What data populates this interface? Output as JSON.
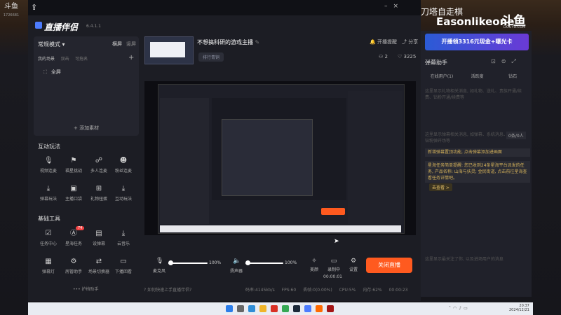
{
  "overlay": {
    "logo": "斗鱼",
    "logo_sub": "1726681",
    "streamer_name": "刀塔自走棋",
    "streamer_id": "Easonlikeone",
    "brand": "斗鱼",
    "brand_url": "DOUYU.COM"
  },
  "app": {
    "name": "直播伴侣",
    "version": "6.4.1.1",
    "mode": "常规模式 ▾",
    "orient_h": "横屏",
    "orient_v": "竖屏",
    "scene_tabs": [
      "我的场景",
      "双击",
      "可拖名"
    ],
    "source_item": "全屏",
    "add_source": "+ 添加素材"
  },
  "interact": {
    "title": "互动玩法",
    "items": [
      {
        "label": "视频连麦",
        "icon": "mic-icon"
      },
      {
        "label": "福星挑战",
        "icon": "star-icon"
      },
      {
        "label": "多人连麦",
        "icon": "people-icon"
      },
      {
        "label": "粉丝连麦",
        "icon": "fans-icon"
      },
      {
        "label": "弹幕玩法",
        "icon": "download-icon"
      },
      {
        "label": "主播口袋",
        "icon": "pocket-icon"
      },
      {
        "label": "礼物扭蛋",
        "icon": "gift-icon"
      },
      {
        "label": "互动玩法",
        "icon": "game-icon"
      }
    ]
  },
  "tools": {
    "title": "基础工具",
    "badge": "74",
    "items": [
      {
        "label": "任务中心",
        "icon": "task-icon"
      },
      {
        "label": "星海任务",
        "icon": "ad-icon"
      },
      {
        "label": "设弹幕",
        "icon": "danmu-icon"
      },
      {
        "label": "云音乐",
        "icon": "music-icon"
      },
      {
        "label": "弹幕灯",
        "icon": "lamp-icon"
      },
      {
        "label": "房管助手",
        "icon": "admin-icon"
      },
      {
        "label": "场景切换器",
        "icon": "switch-icon"
      },
      {
        "label": "下播回看",
        "icon": "replay-icon"
      }
    ],
    "more": "••• 护档助手"
  },
  "header": {
    "stream_title": "不想搞科研的游戏主播",
    "category": "排行青铜",
    "open_alert": "开播提醒",
    "share": "分享",
    "connections": "2",
    "likes": "3225"
  },
  "controls": {
    "mic_label": "麦克风",
    "mic_value": "100%",
    "speaker_label": "扬声器",
    "speaker_value": "100%",
    "beauty_label": "美颜",
    "record_label": "录制中",
    "record_time": "00:00:01",
    "settings_label": "设置",
    "end_live": "关闭直播"
  },
  "status": {
    "help": "如何快速上手直播伴侣?",
    "bitrate": "码率:4145kb/s",
    "fps": "FPS:60",
    "drop": "丢帧:0(0.00%)",
    "cpu": "CPU:5%",
    "mem": "内存:62%",
    "time": "00:00:23"
  },
  "right": {
    "banner": "开播领3316元现金+曝光卡",
    "title": "弹幕助手",
    "tabs": [
      "在线用户(1)",
      "活跃度",
      "钻石"
    ],
    "hint1": "这里显示礼物相关消息, 如礼物、送礼、贵族开通/续费、钻粉开通/续费等",
    "hint2": "这里显示弹幕相关消息, 如弹幕、系统消息、钻粉弹开场等",
    "count": "0条/0人",
    "notice1": "新增弹幕置顶功能, 点击弹幕添加进画面",
    "notice2": "星海任务简单提醒: 您已收到24条星海平台派发的任务, 产品名称: 山海与扶灵; 金民街道, 点击前往星海查看任务详情吧。",
    "more": "去查看 >",
    "hint3": "这里显示最关注了你, 以及进场用户的消息"
  },
  "taskbar": {
    "time": "20:37",
    "date": "2024/12/21"
  }
}
